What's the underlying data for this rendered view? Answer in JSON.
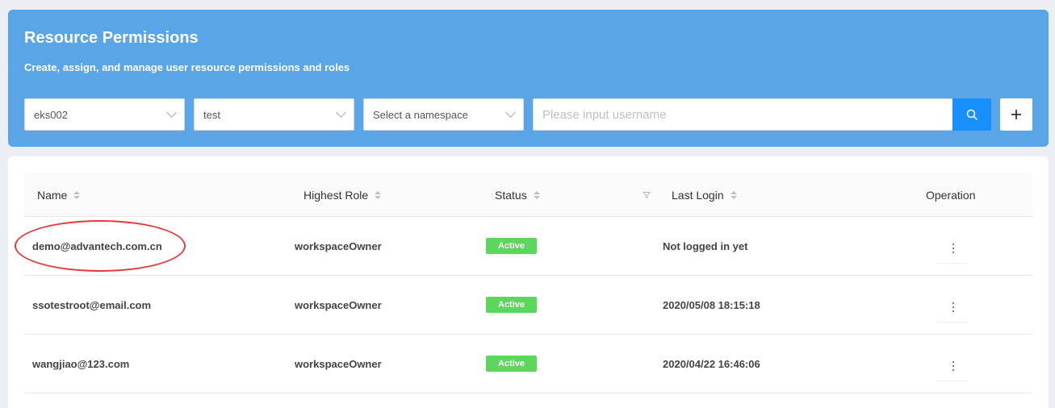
{
  "header": {
    "title": "Resource Permissions",
    "subtitle": "Create, assign, and manage user resource permissions and roles"
  },
  "filters": {
    "cluster": "eks002",
    "workspace": "test",
    "namespace_placeholder": "Select a namespace",
    "username_placeholder": "Please input username"
  },
  "icons": {
    "search": "search-icon",
    "add": "plus-icon",
    "filter": "filter-icon",
    "more": "more-vertical-icon"
  },
  "colors": {
    "header_bg": "#59a5e8",
    "primary": "#1890ff",
    "status_active": "#5cd65c",
    "annotation": "#e23b3b"
  },
  "table": {
    "columns": {
      "name": "Name",
      "role": "Highest Role",
      "status": "Status",
      "last_login": "Last Login",
      "operation": "Operation"
    },
    "rows": [
      {
        "name": "demo@advantech.com.cn",
        "role": "workspaceOwner",
        "status": "Active",
        "last_login": "Not logged in yet"
      },
      {
        "name": "ssotestroot@email.com",
        "role": "workspaceOwner",
        "status": "Active",
        "last_login": "2020/05/08 18:15:18"
      },
      {
        "name": "wangjiao@123.com",
        "role": "workspaceOwner",
        "status": "Active",
        "last_login": "2020/04/22 16:46:06"
      }
    ]
  }
}
